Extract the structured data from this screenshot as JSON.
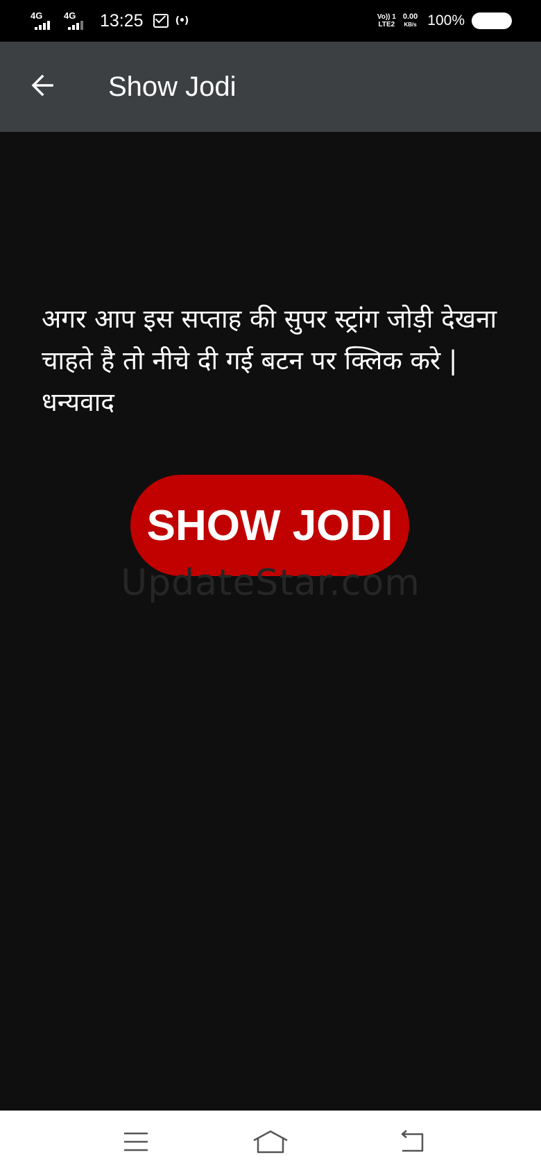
{
  "status_bar": {
    "network1": "4G",
    "network2": "4G",
    "time": "13:25",
    "volte_top": "Vo)) 1",
    "volte_bottom": "LTE2",
    "speed_value": "0.00",
    "speed_unit": "KB/s",
    "battery": "100%"
  },
  "app_bar": {
    "title": "Show Jodi",
    "back_icon": "arrow-left-icon"
  },
  "main": {
    "message": "अगर आप इस सप्ताह की सुपर स्ट्रांग जोड़ी देखना चाहते है तो नीचे दी गई बटन पर क्लिक करे | धन्यवाद",
    "button_label": "SHOW JODI",
    "watermark": "UpdateStar.com"
  },
  "nav_bar": {
    "icons": [
      "menu-icon",
      "home-icon",
      "back-icon"
    ]
  },
  "colors": {
    "background": "#0f0f0f",
    "app_bar": "#3d4043",
    "button": "#c10000",
    "nav_bar": "#ffffff"
  }
}
